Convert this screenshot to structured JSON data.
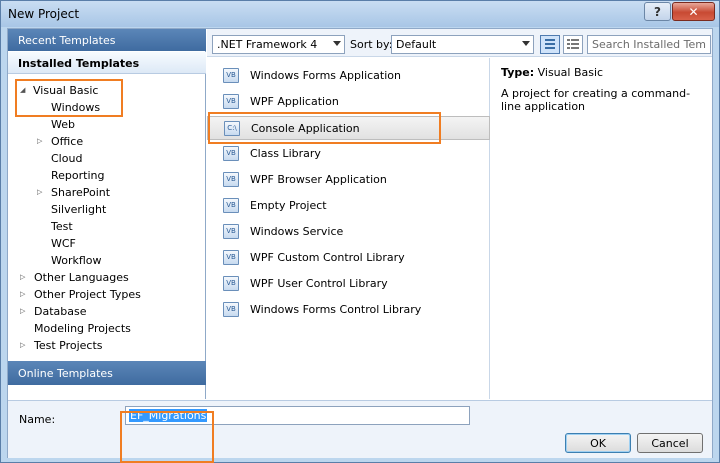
{
  "window": {
    "title": "New Project",
    "help_label": "?",
    "close_label": "✕"
  },
  "left": {
    "recent_templates": "Recent Templates",
    "installed_templates": "Installed Templates",
    "online_templates": "Online Templates",
    "tree": [
      {
        "label": "Visual Basic",
        "expander": "◢"
      },
      {
        "label": "Windows"
      },
      {
        "label": "Web"
      },
      {
        "label": "Office",
        "expander": "▷"
      },
      {
        "label": "Cloud"
      },
      {
        "label": "Reporting"
      },
      {
        "label": "SharePoint",
        "expander": "▷"
      },
      {
        "label": "Silverlight"
      },
      {
        "label": "Test"
      },
      {
        "label": "WCF"
      },
      {
        "label": "Workflow"
      },
      {
        "label": "Other Languages",
        "expander": "▷"
      },
      {
        "label": "Other Project Types",
        "expander": "▷"
      },
      {
        "label": "Database",
        "expander": "▷"
      },
      {
        "label": "Modeling Projects"
      },
      {
        "label": "Test Projects",
        "expander": "▷"
      }
    ]
  },
  "toolbar": {
    "framework": ".NET Framework 4",
    "sort_by_label": "Sort by:",
    "sort_value": "Default",
    "search_placeholder": "Search Installed Tem"
  },
  "templates": [
    {
      "label": "Windows Forms Application",
      "icon": "VB"
    },
    {
      "label": "WPF Application",
      "icon": "VB"
    },
    {
      "label": "Console Application",
      "icon": "C:\\"
    },
    {
      "label": "Class Library",
      "icon": "VB"
    },
    {
      "label": "WPF Browser Application",
      "icon": "VB"
    },
    {
      "label": "Empty Project",
      "icon": "VB"
    },
    {
      "label": "Windows Service",
      "icon": "VB"
    },
    {
      "label": "WPF Custom Control Library",
      "icon": "VB"
    },
    {
      "label": "WPF User Control Library",
      "icon": "VB"
    },
    {
      "label": "Windows Forms Control Library",
      "icon": "VB"
    }
  ],
  "description": {
    "type_label": "Type:",
    "type_value": "Visual Basic",
    "text": "A project for creating a command-line application"
  },
  "bottom": {
    "name_label": "Name:",
    "name_value": "EF_Migrations",
    "ok_label": "OK",
    "cancel_label": "Cancel"
  },
  "colors": {
    "highlight": "#f07d22",
    "header_blue": "#4a77ad",
    "selection": "#3399ff"
  }
}
